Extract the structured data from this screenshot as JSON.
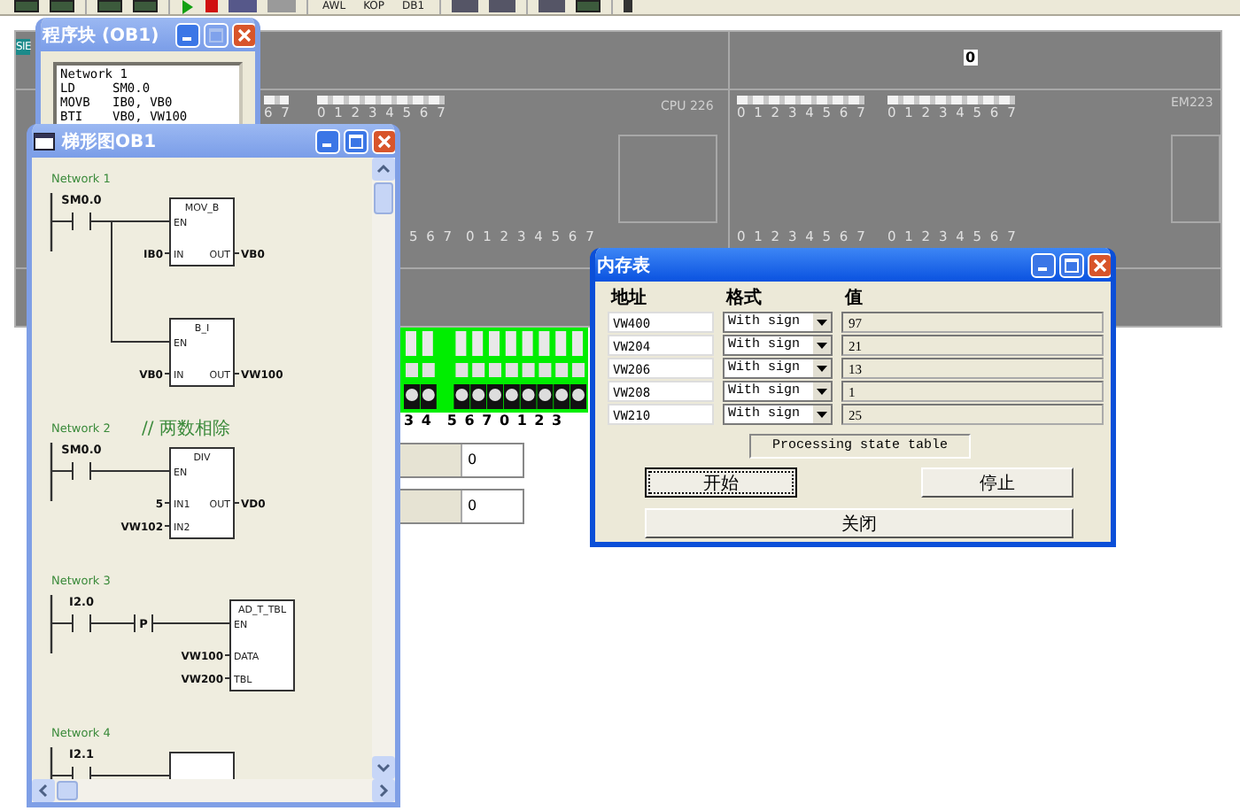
{
  "toolbar": {
    "labels": [
      "AWL",
      "KOP",
      "DB1"
    ]
  },
  "plc": {
    "brand": "SIE",
    "cpu": "CPU 226",
    "display": "0",
    "module": "EM223",
    "led_groups": [
      {
        "kind": "input",
        "labels": "6 7"
      },
      {
        "kind": "input",
        "labels": "0 1 2 3 4 5 6 7"
      },
      {
        "kind": "input",
        "labels": "0 1 2 3 4 5 6 7"
      },
      {
        "kind": "input",
        "labels": "0 1 2 3 4 5 6 7"
      },
      {
        "kind": "output",
        "labels": "5 6 7"
      },
      {
        "kind": "output",
        "labels": "0 1 2 3 4 5 6 7"
      },
      {
        "kind": "output",
        "labels": "0 1 2 3 4 5 6 7"
      },
      {
        "kind": "output",
        "labels": "0 1 2 3 4 5 6 7"
      }
    ],
    "terminal_labels": [
      "3 4",
      "5 6 7 0 1 2 3"
    ],
    "value_fields": [
      "0",
      "0"
    ]
  },
  "program_block": {
    "title": "程序块 (OB1)",
    "active": false,
    "maximize_disabled": true,
    "lines": [
      "Network 1",
      "LD     SM0.0",
      "MOVB   IB0, VB0",
      "BTI    VB0, VW100"
    ]
  },
  "ladder": {
    "title": "梯形图OB1",
    "active": false,
    "maximize_disabled": false,
    "networks": [
      {
        "title": "Network 1",
        "contact": "SM0.0",
        "boxes": [
          {
            "kind": "function",
            "name": "MOV_B",
            "inputs": [
              {
                "pin": "EN"
              },
              {
                "pin": "IN",
                "operand": "IB0"
              }
            ],
            "outputs": [
              {
                "pin": "OUT",
                "operand": "VB0"
              }
            ]
          },
          {
            "kind": "function",
            "name": "B_I",
            "inputs": [
              {
                "pin": "EN"
              },
              {
                "pin": "IN",
                "operand": "VB0"
              }
            ],
            "outputs": [
              {
                "pin": "OUT",
                "operand": "VW100"
              }
            ]
          }
        ]
      },
      {
        "title": "Network 2",
        "comment": "// 两数相除",
        "contact": "SM0.0",
        "boxes": [
          {
            "kind": "function",
            "name": "DIV",
            "inputs": [
              {
                "pin": "EN"
              },
              {
                "pin": "IN1",
                "operand": "5"
              },
              {
                "pin": "IN2",
                "operand": "VW102"
              }
            ],
            "outputs": [
              {
                "pin": "OUT",
                "operand": "VD0"
              }
            ]
          }
        ]
      },
      {
        "title": "Network 3",
        "contact": "I2.0",
        "edge": "P",
        "boxes": [
          {
            "kind": "function",
            "name": "AD_T_TBL",
            "inputs": [
              {
                "pin": "EN"
              },
              {
                "pin": "DATA",
                "operand": "VW100"
              },
              {
                "pin": "TBL",
                "operand": "VW200"
              }
            ]
          }
        ]
      },
      {
        "title": "Network 4",
        "contact": "I2.1",
        "boxes": [
          {
            "kind": "cut"
          }
        ]
      }
    ]
  },
  "memory_table": {
    "title": "内存表",
    "active": true,
    "maximize_disabled": false,
    "headers": [
      "地址",
      "格式",
      "值"
    ],
    "rows": [
      {
        "address": "VW400",
        "format": "With sign",
        "value": "97"
      },
      {
        "address": "VW204",
        "format": "With sign",
        "value": "21"
      },
      {
        "address": "VW206",
        "format": "With sign",
        "value": "13"
      },
      {
        "address": "VW208",
        "format": "With sign",
        "value": "1"
      },
      {
        "address": "VW210",
        "format": "With sign",
        "value": "25"
      }
    ],
    "status": "Processing state table",
    "buttons": [
      {
        "label": "开始",
        "focused": true
      },
      {
        "label": "停止",
        "focused": false
      },
      {
        "label": "关闭",
        "focused": false
      }
    ]
  }
}
